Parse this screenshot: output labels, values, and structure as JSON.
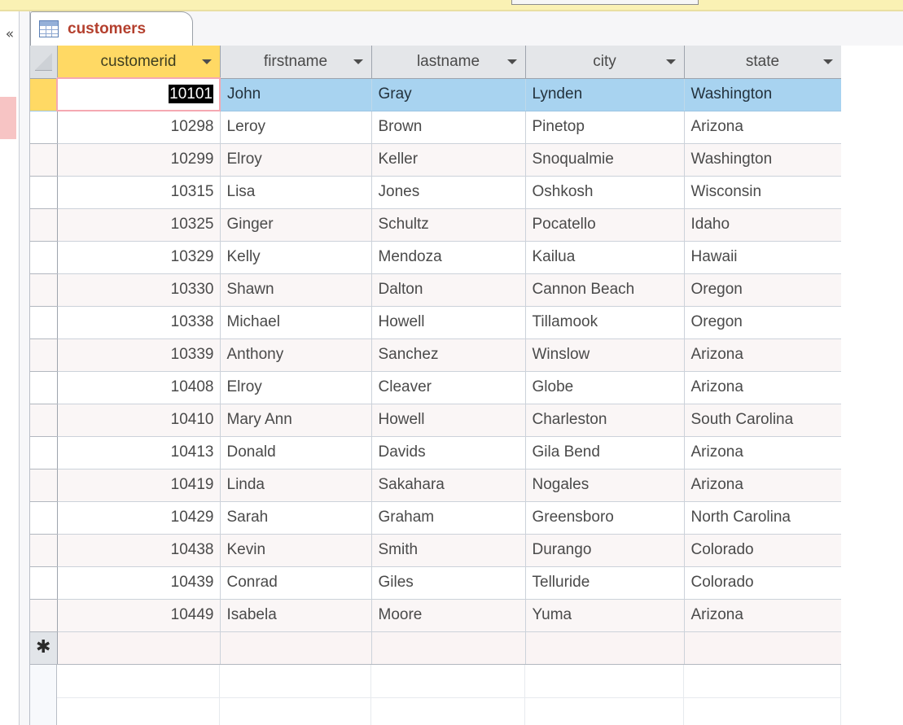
{
  "window": {
    "application": "Microsoft Access",
    "ribbon_strip_color": "#faf1b4"
  },
  "nav_pane": {
    "state": "collapsed",
    "collapse_icon": "«",
    "collapse_icon_name": "chevron-double-left-icon",
    "selected_object_highlight_color": "#f7c4c4"
  },
  "document_tabs": [
    {
      "label": "customers",
      "icon": "table-icon",
      "active": true
    }
  ],
  "datasheet": {
    "object_name": "customers",
    "columns": [
      {
        "key": "customerid",
        "label": "customerid",
        "active": true,
        "align": "right"
      },
      {
        "key": "firstname",
        "label": "firstname",
        "active": false,
        "align": "left"
      },
      {
        "key": "lastname",
        "label": "lastname",
        "active": false,
        "align": "left"
      },
      {
        "key": "city",
        "label": "city",
        "active": false,
        "align": "left"
      },
      {
        "key": "state",
        "label": "state",
        "active": false,
        "align": "left"
      }
    ],
    "select_all_corner_icon": "select-all-triangle-icon",
    "header_caret_icon": "chevron-down-icon",
    "active_column_color": "#ffd964",
    "selected_row_color": "#a8d3f0",
    "active_cell_border_color": "#f5a8b2",
    "rows": [
      {
        "customerid": "10101",
        "firstname": "John",
        "lastname": "Gray",
        "city": "Lynden",
        "state": "Washington",
        "selected": true
      },
      {
        "customerid": "10298",
        "firstname": "Leroy",
        "lastname": "Brown",
        "city": "Pinetop",
        "state": "Arizona",
        "selected": false
      },
      {
        "customerid": "10299",
        "firstname": "Elroy",
        "lastname": "Keller",
        "city": "Snoqualmie",
        "state": "Washington",
        "selected": false
      },
      {
        "customerid": "10315",
        "firstname": "Lisa",
        "lastname": "Jones",
        "city": "Oshkosh",
        "state": "Wisconsin",
        "selected": false
      },
      {
        "customerid": "10325",
        "firstname": "Ginger",
        "lastname": "Schultz",
        "city": "Pocatello",
        "state": "Idaho",
        "selected": false
      },
      {
        "customerid": "10329",
        "firstname": "Kelly",
        "lastname": "Mendoza",
        "city": "Kailua",
        "state": "Hawaii",
        "selected": false
      },
      {
        "customerid": "10330",
        "firstname": "Shawn",
        "lastname": "Dalton",
        "city": "Cannon Beach",
        "state": "Oregon",
        "selected": false
      },
      {
        "customerid": "10338",
        "firstname": "Michael",
        "lastname": "Howell",
        "city": "Tillamook",
        "state": "Oregon",
        "selected": false
      },
      {
        "customerid": "10339",
        "firstname": "Anthony",
        "lastname": "Sanchez",
        "city": "Winslow",
        "state": "Arizona",
        "selected": false
      },
      {
        "customerid": "10408",
        "firstname": "Elroy",
        "lastname": "Cleaver",
        "city": "Globe",
        "state": "Arizona",
        "selected": false
      },
      {
        "customerid": "10410",
        "firstname": "Mary Ann",
        "lastname": "Howell",
        "city": "Charleston",
        "state": "South Carolina",
        "selected": false
      },
      {
        "customerid": "10413",
        "firstname": "Donald",
        "lastname": "Davids",
        "city": "Gila Bend",
        "state": "Arizona",
        "selected": false
      },
      {
        "customerid": "10419",
        "firstname": "Linda",
        "lastname": "Sakahara",
        "city": "Nogales",
        "state": "Arizona",
        "selected": false
      },
      {
        "customerid": "10429",
        "firstname": "Sarah",
        "lastname": "Graham",
        "city": "Greensboro",
        "state": "North Carolina",
        "selected": false
      },
      {
        "customerid": "10438",
        "firstname": "Kevin",
        "lastname": "Smith",
        "city": "Durango",
        "state": "Colorado",
        "selected": false
      },
      {
        "customerid": "10439",
        "firstname": "Conrad",
        "lastname": "Giles",
        "city": "Telluride",
        "state": "Colorado",
        "selected": false
      },
      {
        "customerid": "10449",
        "firstname": "Isabela",
        "lastname": "Moore",
        "city": "Yuma",
        "state": "Arizona",
        "selected": false
      }
    ],
    "new_record_row": {
      "indicator": "✱",
      "indicator_name": "new-record-asterisk-icon",
      "customerid": "",
      "firstname": "",
      "lastname": "",
      "city": "",
      "state": ""
    },
    "active_cell": {
      "column": "customerid",
      "row_index": 0,
      "value": "10101",
      "text_selected": true
    }
  }
}
